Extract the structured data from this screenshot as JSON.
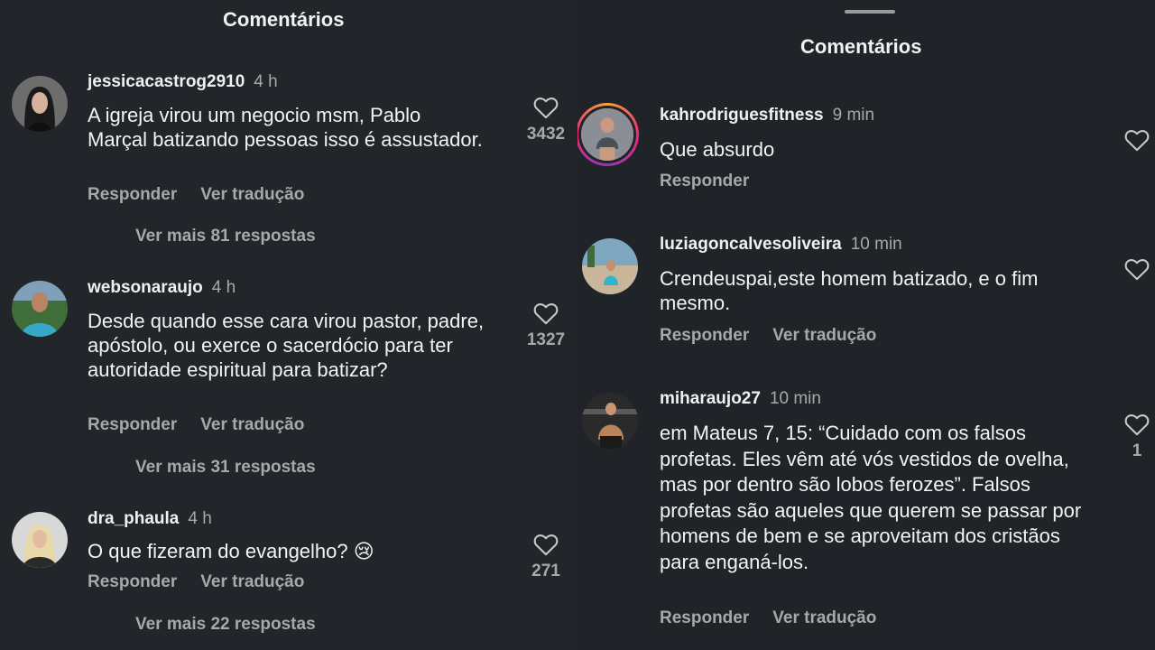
{
  "left_panel": {
    "title": "Comentários",
    "comments": [
      {
        "username": "jessicacastrog2910",
        "time": "4 h",
        "text": "A igreja virou um negocio msm, Pablo Marçal batizando pessoas isso é assustador.",
        "reply": "Responder",
        "translate": "Ver tradução",
        "more_replies": "Ver mais 81 respostas",
        "likes": "3432",
        "avatar": "avatar-woman-dark-hair"
      },
      {
        "username": "websonaraujo",
        "time": "4 h",
        "text": "Desde quando esse cara virou pastor, padre, apóstolo, ou exerce o sacerdócio para ter autoridade espiritual para batizar?",
        "reply": "Responder",
        "translate": "Ver tradução",
        "more_replies": "Ver mais 31 respostas",
        "likes": "1327",
        "avatar": "avatar-man-outdoors"
      },
      {
        "username": "dra_phaula",
        "time": "4 h",
        "text": "O que fizeram do evangelho? 😢",
        "reply": "Responder",
        "translate": "Ver tradução",
        "more_replies": "Ver mais 22 respostas",
        "likes": "271",
        "avatar": "avatar-woman-blonde"
      }
    ]
  },
  "right_panel": {
    "title": "Comentários",
    "comments": [
      {
        "username": "kahrodriguesfitness",
        "time": "9 min",
        "text": "Que absurdo",
        "reply": "Responder",
        "avatar": "avatar-story-ring-woman"
      },
      {
        "username": "luziagoncalvesoliveira",
        "time": "10 min",
        "text": "Crendeuspai,este homem batizado, e o fim mesmo.",
        "reply": "Responder",
        "translate": "Ver tradução",
        "avatar": "avatar-beach"
      },
      {
        "username": "miharaujo27",
        "time": "10 min",
        "text": "em Mateus 7, 15: “Cuidado com os falsos profetas. Eles vêm até vós vestidos de ovelha, mas por dentro são lobos ferozes”. Falsos profetas são aqueles que querem se passar por homens de bem e se aproveitam dos cristãos para enganá-los.",
        "reply": "Responder",
        "translate": "Ver tradução",
        "likes": "1",
        "avatar": "avatar-gym"
      }
    ]
  },
  "colors": {
    "background": "#222529",
    "secondary_text": "#a8a8a8",
    "primary_text": "#f3f3f3"
  }
}
